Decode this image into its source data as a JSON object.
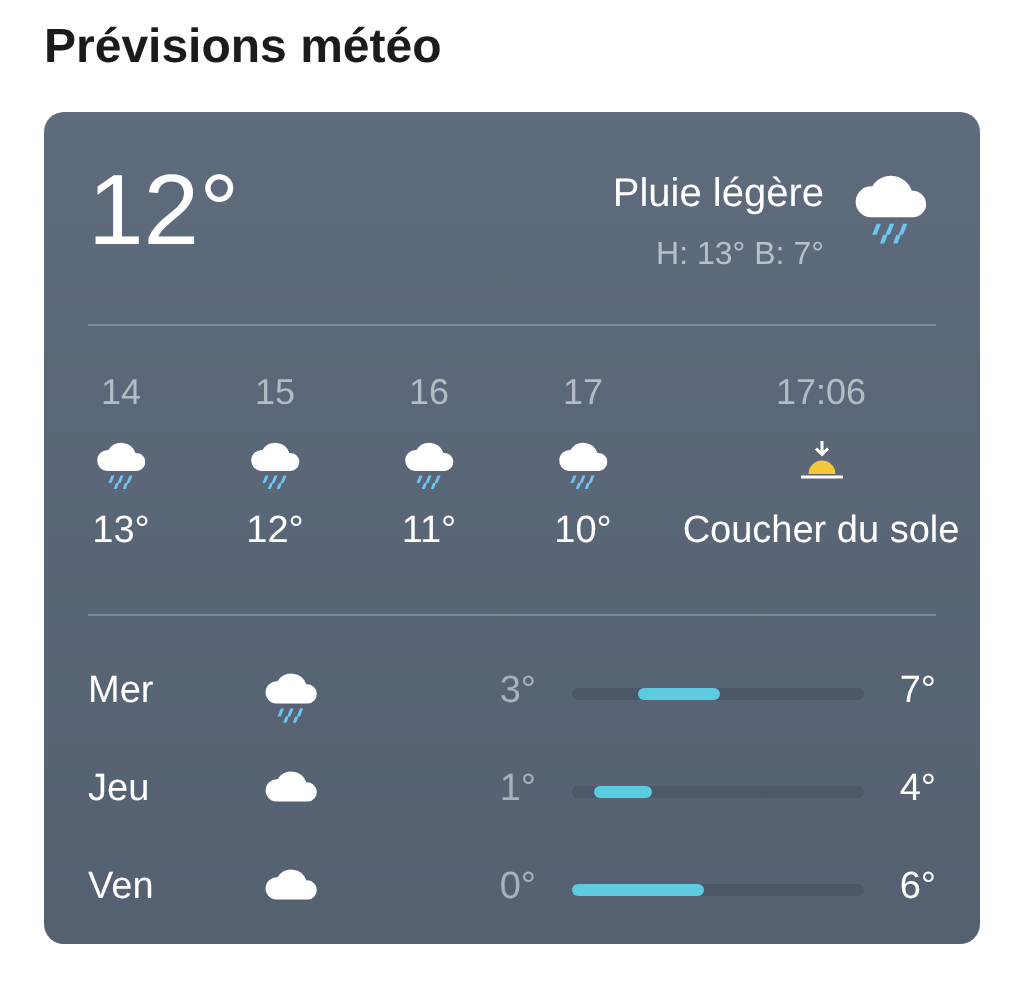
{
  "title": "Prévisions météo",
  "current": {
    "temperature": "12°",
    "condition": "Pluie légère",
    "high_low": "H: 13° B: 7°",
    "kind": "rain"
  },
  "hourly": [
    {
      "time": "14",
      "kind": "rain",
      "temperature": "13°"
    },
    {
      "time": "15",
      "kind": "rain",
      "temperature": "12°"
    },
    {
      "time": "16",
      "kind": "rain",
      "temperature": "11°"
    },
    {
      "time": "17",
      "kind": "rain",
      "temperature": "10°"
    },
    {
      "time": "17:06",
      "kind": "sunset",
      "temperature": "Coucher du sole"
    }
  ],
  "daily": [
    {
      "day": "Mer",
      "kind": "rain",
      "low": "3°",
      "high": "7°",
      "level": 0.28
    },
    {
      "day": "Jeu",
      "kind": "cloud",
      "low": "1°",
      "high": "4°",
      "level": 0.2
    },
    {
      "day": "Ven",
      "kind": "cloud",
      "low": "0°",
      "high": "6°",
      "level": 0.45
    }
  ]
}
